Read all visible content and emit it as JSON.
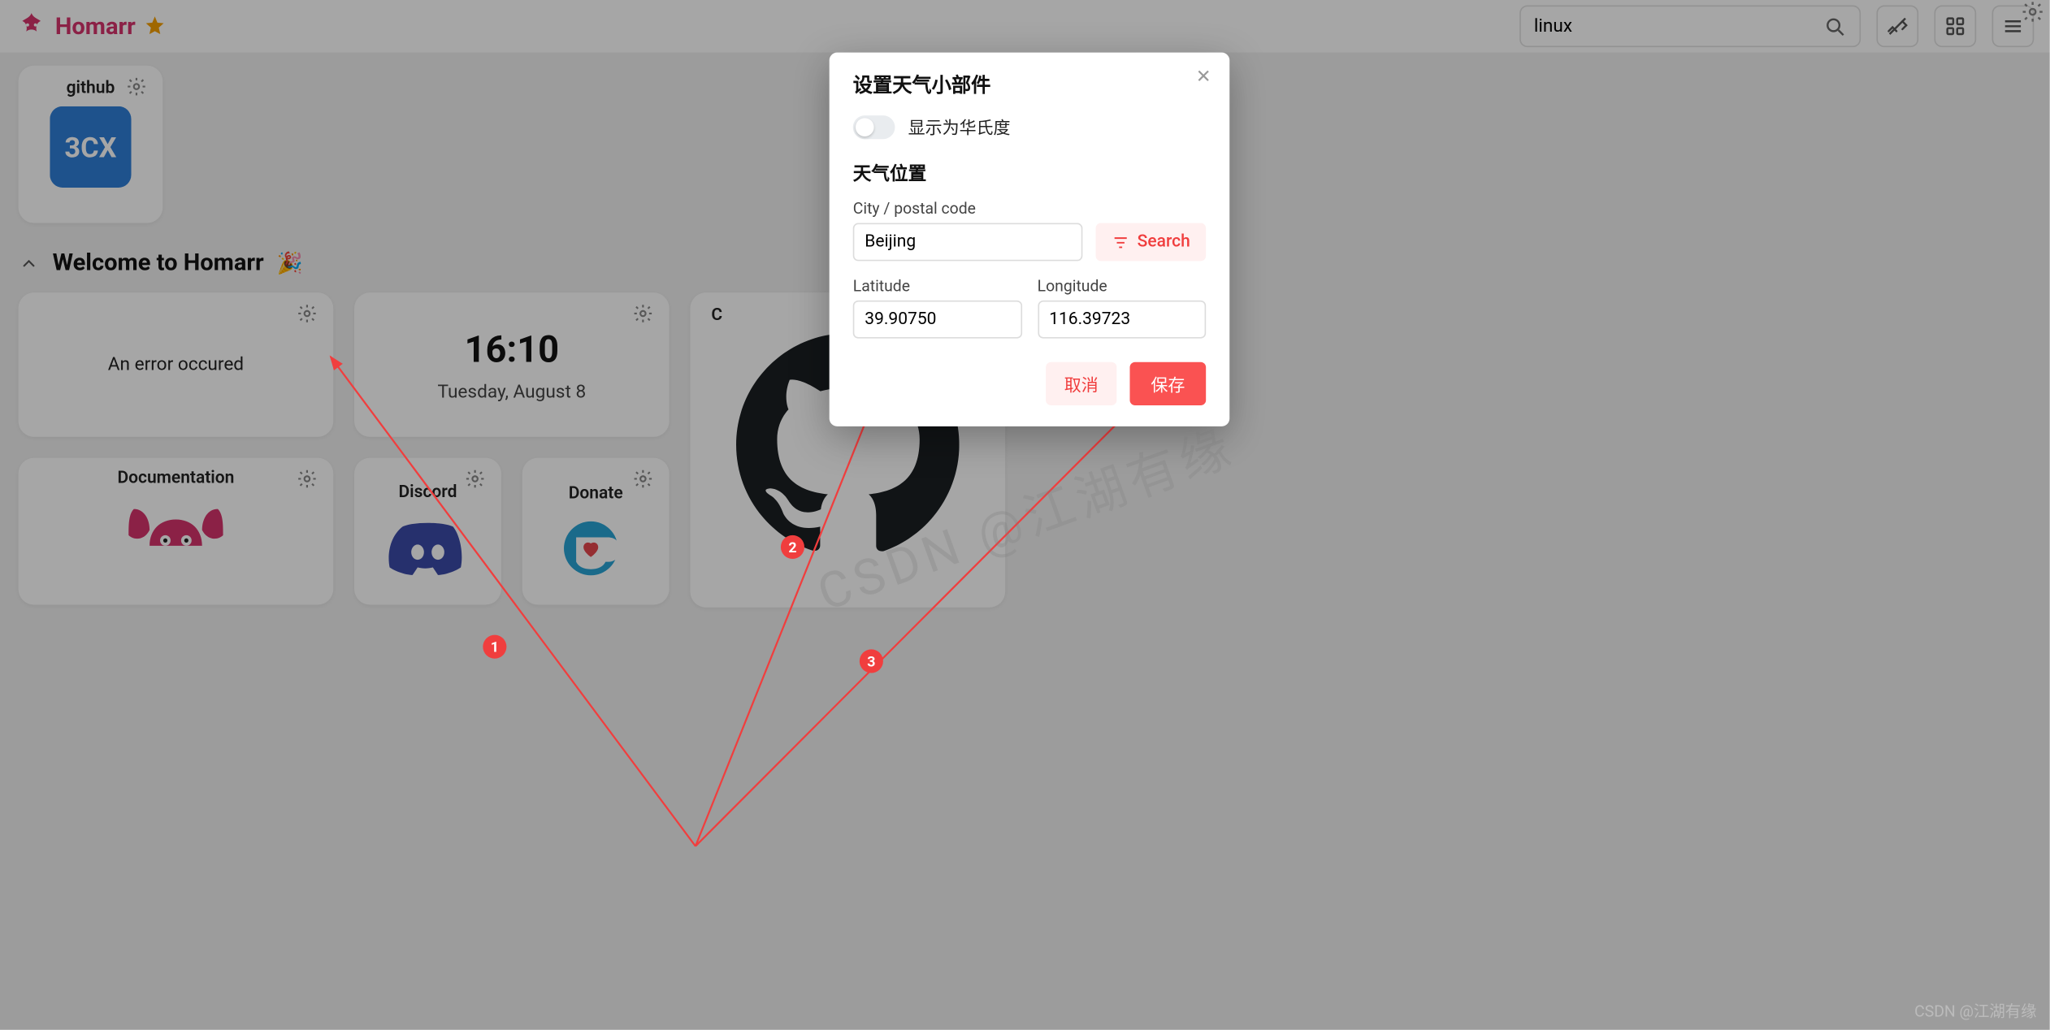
{
  "header": {
    "brand": "Homarr",
    "search_value": "linux"
  },
  "tiles": {
    "github_label": "github",
    "threecx_text": "3CX"
  },
  "section": {
    "title": "Welcome to Homarr",
    "emoji": "🎉",
    "weather_error": "An error occured",
    "clock_time": "16:10",
    "clock_date": "Tuesday, August 8",
    "doc_label": "Documentation",
    "discord_label": "Discord",
    "donate_label": "Donate",
    "contribute_label": "C"
  },
  "modal": {
    "title": "设置天气小部件",
    "fahrenheit_label": "显示为华氏度",
    "location_title": "天气位置",
    "city_label": "City / postal code",
    "city_value": "Beijing",
    "search_label": "Search",
    "lat_label": "Latitude",
    "lat_value": "39.90750",
    "lon_label": "Longitude",
    "lon_value": "116.39723",
    "cancel": "取消",
    "save": "保存"
  },
  "annotations": {
    "badge1": "1",
    "badge2": "2",
    "badge3": "3"
  },
  "watermark": {
    "diagonal": "CSDN @江湖有缘",
    "corner": "CSDN @江湖有缘"
  }
}
